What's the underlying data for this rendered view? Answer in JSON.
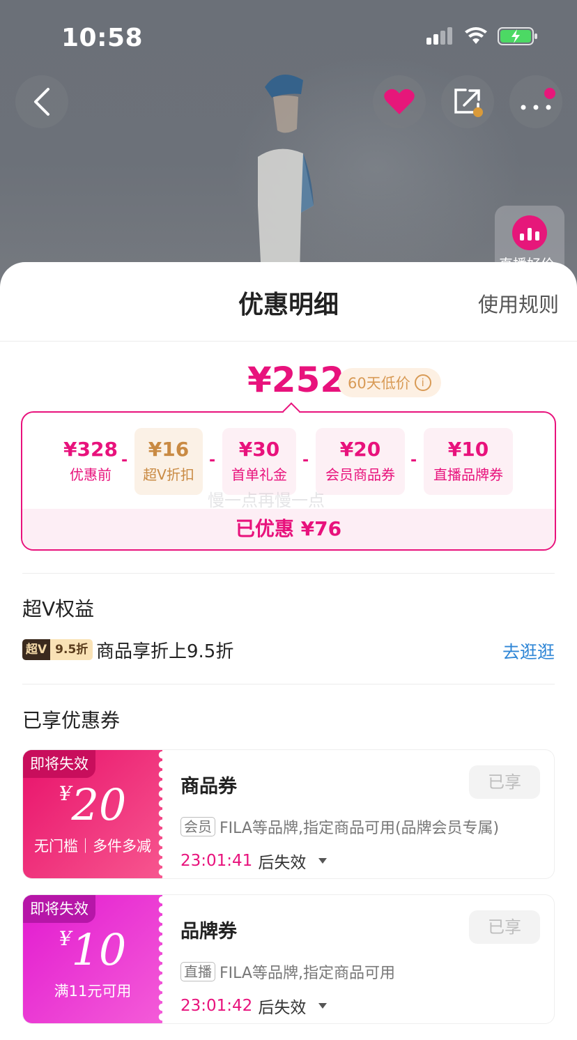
{
  "status_bar": {
    "time": "10:58"
  },
  "hero": {
    "live_label": "直播好价"
  },
  "sheet": {
    "title": "优惠明细",
    "rules_link": "使用规则",
    "final_price": "¥252",
    "low_price_badge": "60天低价",
    "breakdown": [
      {
        "amount": "¥328",
        "label": "优惠前"
      },
      {
        "amount": "¥16",
        "label": "超V折扣"
      },
      {
        "amount": "¥30",
        "label": "首单礼金"
      },
      {
        "amount": "¥20",
        "label": "会员商品券"
      },
      {
        "amount": "¥10",
        "label": "直播品牌券"
      }
    ],
    "minus_sign": "-",
    "watermark": "慢一点再慢一点",
    "saved_total": "已优惠 ¥76"
  },
  "super_v": {
    "section_title": "超V权益",
    "badge_left": "超V",
    "badge_right": "9.5折",
    "text": "商品享折上9.5折",
    "link": "去逛逛"
  },
  "coupons": {
    "section_title": "已享优惠券",
    "items": [
      {
        "tag": "即将失效",
        "currency": "¥",
        "amount": "20",
        "condition": "无门槛｜多件多减",
        "name": "商品券",
        "status": "已享",
        "chip": "会员",
        "desc": "FILA等品牌,指定商品可用(品牌会员专属)",
        "expire_time": "23:01:41",
        "expire_suffix": "后失效",
        "color_from": "#e8126b",
        "color_to": "#f7568f"
      },
      {
        "tag": "即将失效",
        "currency": "¥",
        "amount": "10",
        "condition": "满11元可用",
        "name": "品牌券",
        "status": "已享",
        "chip": "直播",
        "desc": "FILA等品牌,指定商品可用",
        "expire_time": "23:01:42",
        "expire_suffix": "后失效",
        "color_from": "#e21bd0",
        "color_to": "#f45bd8"
      }
    ]
  }
}
